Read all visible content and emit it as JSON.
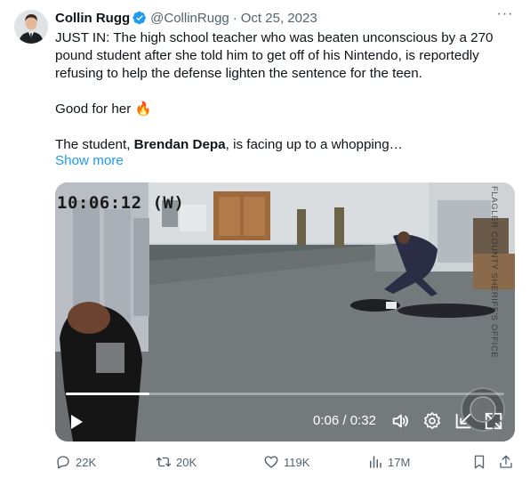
{
  "tweet": {
    "author_name": "Collin Rugg",
    "handle": "@CollinRugg",
    "separator": "·",
    "date": "Oct 25, 2023",
    "more_options": "···",
    "text_line_1": "JUST IN: The high school teacher who was beaten unconscious by a 270 pound student after she told him to get off of his Nintendo, is reportedly refusing to help the defense lighten the sentence for the teen.",
    "text_line_2": "Good for her 🔥",
    "text_line_3_prefix": "The student, ",
    "text_line_3_name": "Brendan Depa",
    "text_line_3_suffix": ", is facing up to a whopping…",
    "show_more": "Show more"
  },
  "video": {
    "timestamp_overlay": "10:06:12 (W)",
    "watermark": "FLAGLER COUNTY SHERIFF'S OFFICE",
    "current_time": "0:06",
    "duration": "0:32",
    "time_separator": " / ",
    "progress_fraction": 0.19
  },
  "actions": {
    "replies": "22K",
    "reposts": "20K",
    "likes": "119K",
    "views": "17M"
  },
  "colors": {
    "accent": "#1d9bf0",
    "muted": "#536471",
    "text": "#0f1419"
  },
  "icons": [
    "verified-badge-icon",
    "more-icon",
    "play-icon",
    "volume-icon",
    "settings-icon",
    "minimize-icon",
    "fullscreen-icon",
    "reply-icon",
    "repost-icon",
    "like-icon",
    "views-icon",
    "bookmark-icon",
    "share-icon"
  ]
}
